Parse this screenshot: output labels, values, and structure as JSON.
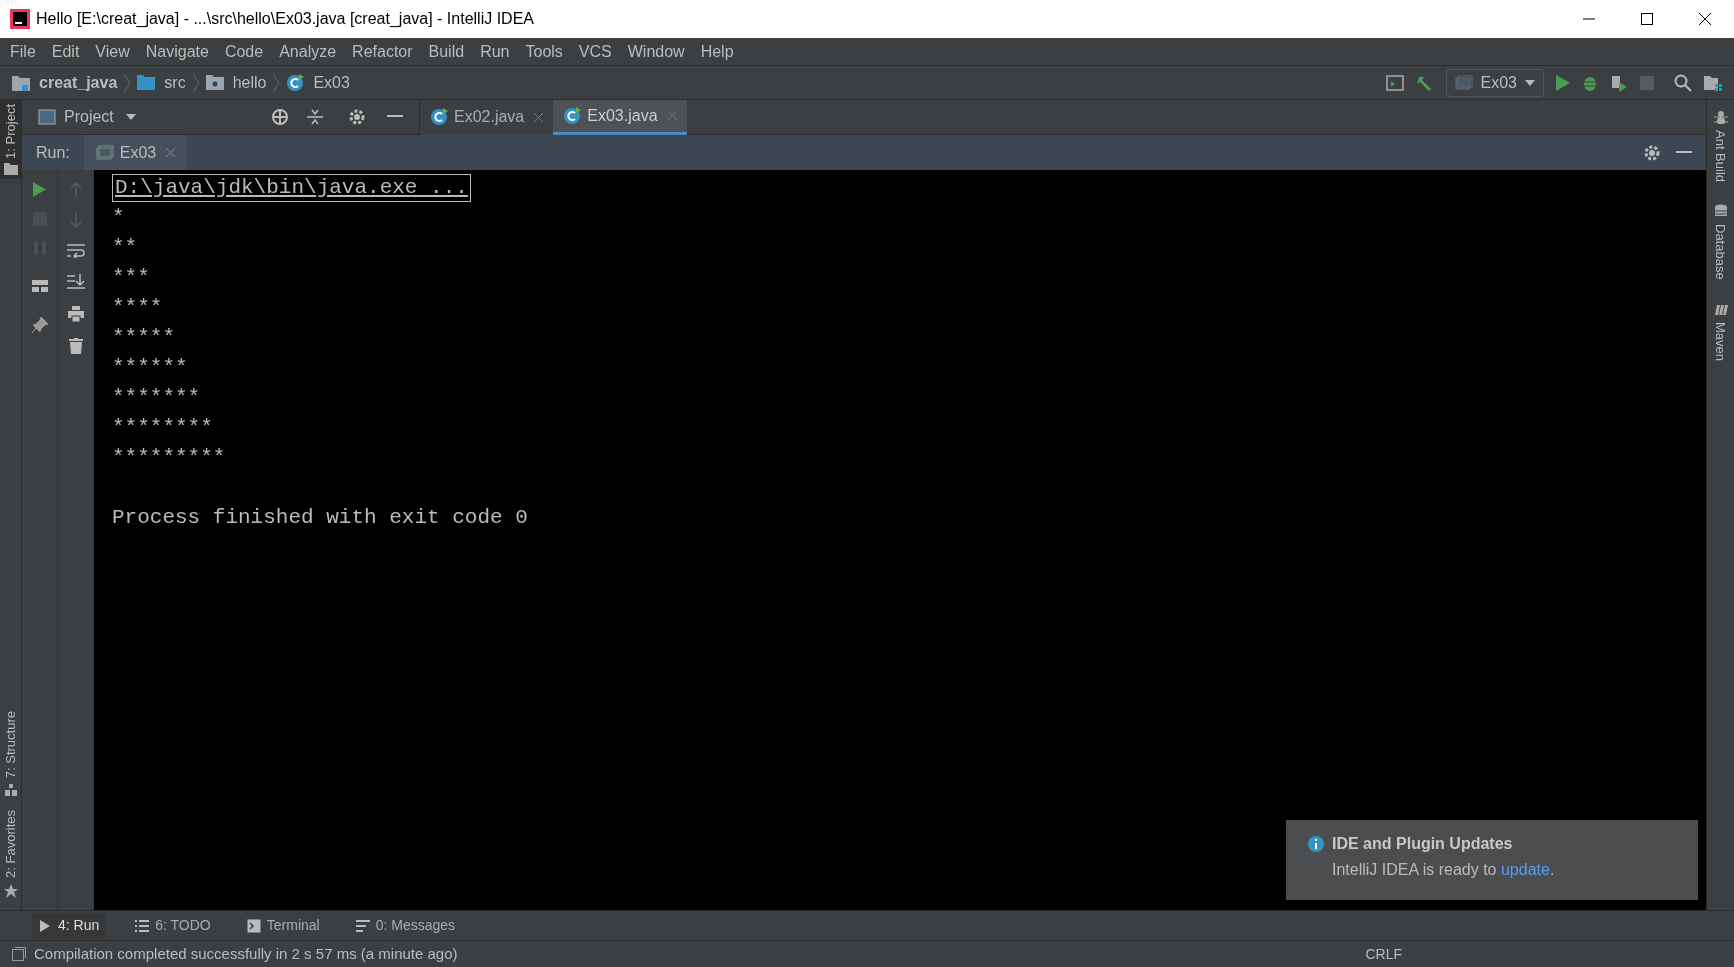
{
  "window": {
    "title": "Hello [E:\\creat_java] - ...\\src\\hello\\Ex03.java [creat_java] - IntelliJ IDEA"
  },
  "menu": [
    "File",
    "Edit",
    "View",
    "Navigate",
    "Code",
    "Analyze",
    "Refactor",
    "Build",
    "Run",
    "Tools",
    "VCS",
    "Window",
    "Help"
  ],
  "breadcrumbs": [
    {
      "label": "creat_java",
      "kind": "project"
    },
    {
      "label": "src",
      "kind": "folder"
    },
    {
      "label": "hello",
      "kind": "package"
    },
    {
      "label": "Ex03",
      "kind": "class"
    }
  ],
  "run_config": "Ex03",
  "project_panel": {
    "title": "Project"
  },
  "editor_tabs": [
    {
      "label": "Ex02.java",
      "selected": false
    },
    {
      "label": "Ex03.java",
      "selected": true
    }
  ],
  "run_panel": {
    "label": "Run:",
    "tab": "Ex03"
  },
  "console": {
    "command": "D:\\java\\jdk\\bin\\java.exe ...",
    "lines": [
      "*",
      "**",
      "***",
      "****",
      "*****",
      "******",
      "*******",
      "********",
      "*********"
    ],
    "exit_message": "Process finished with exit code 0"
  },
  "left_stripe": {
    "top": "1: Project",
    "bottom": [
      "7: Structure",
      "2: Favorites"
    ]
  },
  "right_stripe": [
    "Ant Build",
    "Database",
    "Maven"
  ],
  "bottom_tools": [
    {
      "label": "4: Run",
      "kind": "run",
      "selected": true
    },
    {
      "label": "6: TODO",
      "kind": "todo",
      "selected": false
    },
    {
      "label": "Terminal",
      "kind": "terminal",
      "selected": false
    },
    {
      "label": "0: Messages",
      "kind": "messages",
      "selected": false
    }
  ],
  "notification": {
    "title": "IDE and Plugin Updates",
    "text": "IntelliJ IDEA is ready to ",
    "link": "update",
    "tail": "."
  },
  "status_bar": {
    "message": "Compilation completed successfully in 2 s 57 ms (a minute ago)",
    "items": [
      "CRLF"
    ]
  }
}
